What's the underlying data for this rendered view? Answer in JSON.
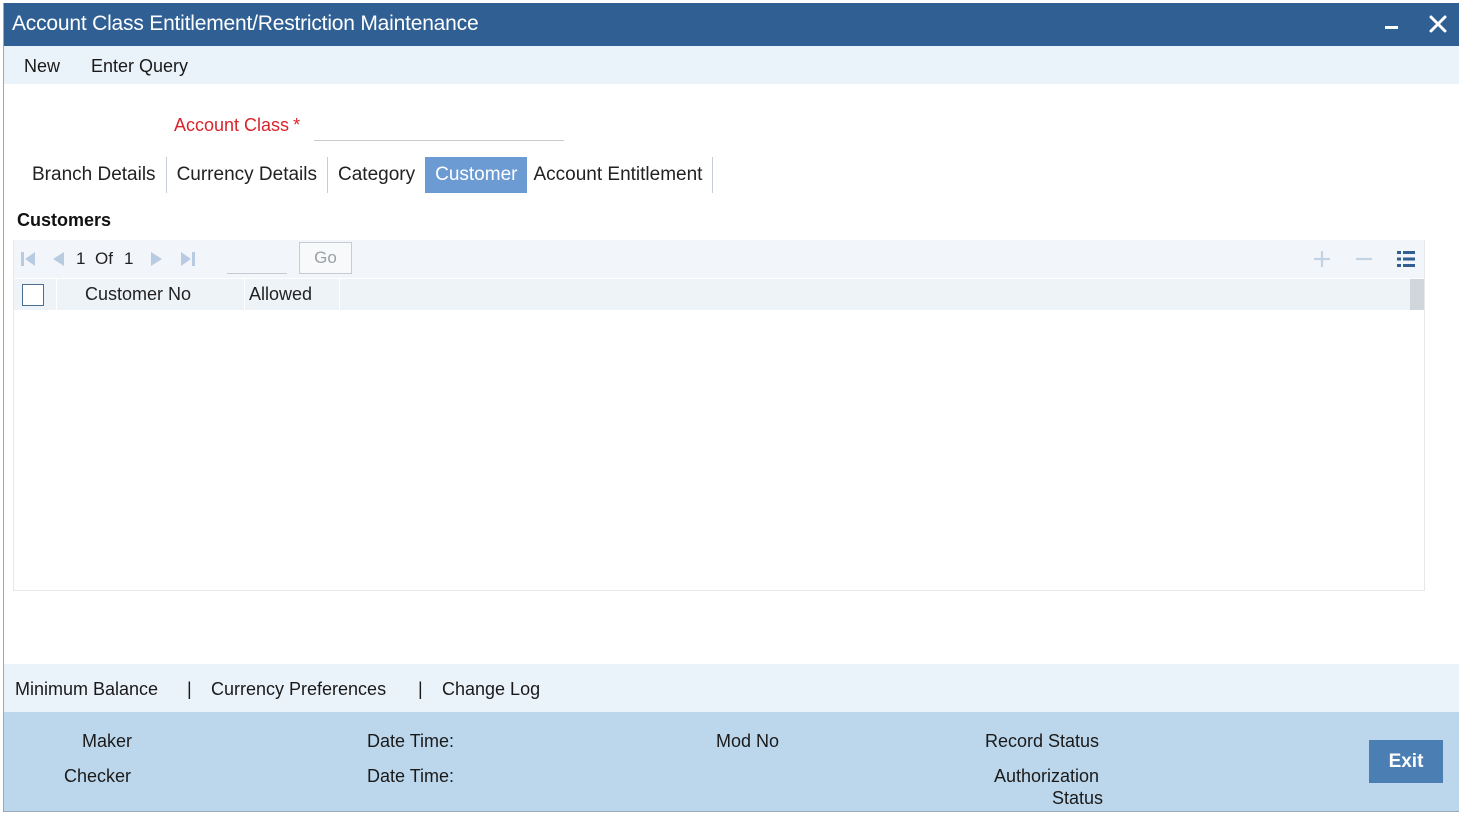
{
  "window": {
    "title": "Account Class Entitlement/Restriction Maintenance",
    "minimize_icon": "minimize-icon",
    "close_icon": "close-icon"
  },
  "toolbar": {
    "new_label": "New",
    "enter_query_label": "Enter Query"
  },
  "form": {
    "account_class_label": "Account Class",
    "required_marker": "*",
    "account_class_value": ""
  },
  "tabs": [
    {
      "label": "Branch Details",
      "active": false
    },
    {
      "label": "Currency Details",
      "active": false
    },
    {
      "label": "Category",
      "active": false
    },
    {
      "label": "Customer",
      "active": true
    },
    {
      "label": "Account Entitlement",
      "active": false
    }
  ],
  "customers": {
    "section_title": "Customers",
    "pager": {
      "current_page": "1",
      "of_label": "Of",
      "total_pages": "1",
      "go_label": "Go"
    },
    "columns": [
      "Customer No",
      "Allowed"
    ],
    "rows": []
  },
  "subscreens": {
    "minimum_balance": "Minimum Balance",
    "separator": "|",
    "currency_preferences": "Currency Preferences",
    "change_log": "Change Log"
  },
  "audit": {
    "maker": "Maker",
    "checker": "Checker",
    "date_time_1": "Date Time:",
    "date_time_2": "Date Time:",
    "mod_no": "Mod No",
    "record_status": "Record Status",
    "authorization_status_line1": "Authorization",
    "authorization_status_line2": "Status",
    "exit_label": "Exit"
  },
  "colors": {
    "title_bar": "#2f5f93",
    "active_tab": "#6b9bd2",
    "required": "#d8242c",
    "audit_panel": "#bcd7ec",
    "exit_button": "#4b7fb3"
  }
}
